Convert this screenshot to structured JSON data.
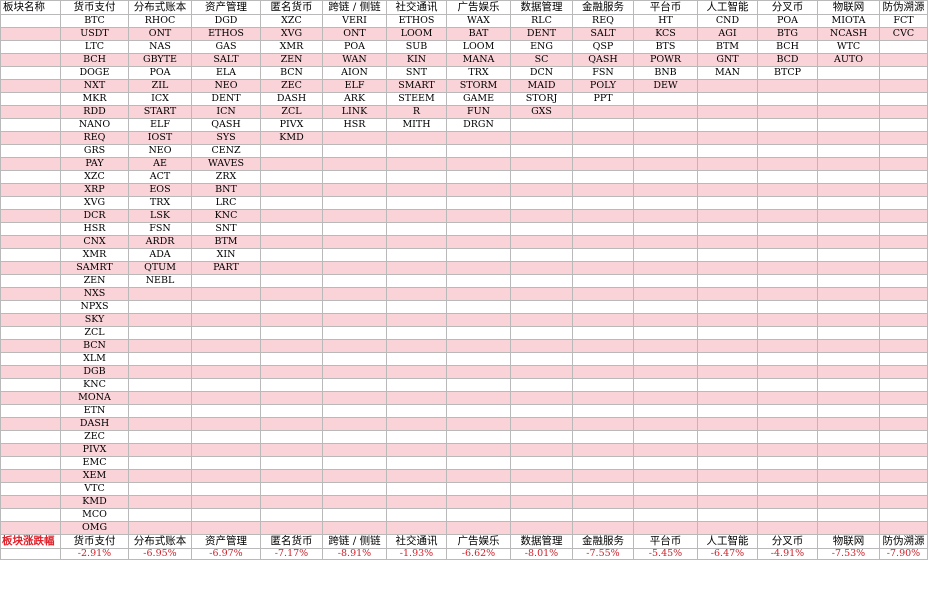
{
  "header": {
    "corner": "板块名称",
    "sectors": [
      "货币支付",
      "分布式账本",
      "资产管理",
      "匿名货币",
      "跨链 / 侧链",
      "社交通讯",
      "广告娱乐",
      "数据管理",
      "金融服务",
      "平台币",
      "人工智能",
      "分叉币",
      "物联网",
      "防伪溯源"
    ]
  },
  "columns": [
    [
      "BTC",
      "USDT",
      "LTC",
      "BCH",
      "DOGE",
      "NXT",
      "MKR",
      "RDD",
      "NANO",
      "REQ",
      "GRS",
      "PAY",
      "XZC",
      "XRP",
      "XVG",
      "DCR",
      "HSR",
      "CNX",
      "XMR",
      "SAMRT",
      "ZEN",
      "NXS",
      "NPXS",
      "SKY",
      "ZCL",
      "BCN",
      "XLM",
      "DGB",
      "KNC",
      "MONA",
      "ETN",
      "DASH",
      "ZEC",
      "PIVX",
      "EMC",
      "XEM",
      "VTC",
      "KMD",
      "MCO",
      "OMG"
    ],
    [
      "RHOC",
      "ONT",
      "NAS",
      "GBYTE",
      "POA",
      "ZIL",
      "ICX",
      "START",
      "ELF",
      "IOST",
      "NEO",
      "AE",
      "ACT",
      "EOS",
      "TRX",
      "LSK",
      "FSN",
      "ARDR",
      "ADA",
      "QTUM",
      "NEBL"
    ],
    [
      "DGD",
      "ETHOS",
      "GAS",
      "SALT",
      "ELA",
      "NEO",
      "DENT",
      "ICN",
      "QASH",
      "SYS",
      "CENZ",
      "WAVES",
      "ZRX",
      "BNT",
      "LRC",
      "KNC",
      "SNT",
      "BTM",
      "XIN",
      "PART"
    ],
    [
      "XZC",
      "XVG",
      "XMR",
      "ZEN",
      "BCN",
      "ZEC",
      "DASH",
      "ZCL",
      "PIVX",
      "KMD"
    ],
    [
      "VERI",
      "ONT",
      "POA",
      "WAN",
      "AION",
      "ELF",
      "ARK",
      "LINK",
      "HSR"
    ],
    [
      "ETHOS",
      "LOOM",
      "SUB",
      "KIN",
      "SNT",
      "SMART",
      "STEEM",
      "R",
      "MITH"
    ],
    [
      "WAX",
      "BAT",
      "LOOM",
      "MANA",
      "TRX",
      "STORM",
      "GAME",
      "FUN",
      "DRGN"
    ],
    [
      "RLC",
      "DENT",
      "ENG",
      "SC",
      "DCN",
      "MAID",
      "STORJ",
      "GXS"
    ],
    [
      "REQ",
      "SALT",
      "QSP",
      "QASH",
      "FSN",
      "POLY",
      "PPT"
    ],
    [
      "HT",
      "KCS",
      "BTS",
      "POWR",
      "BNB",
      "DEW"
    ],
    [
      "CND",
      "AGI",
      "BTM",
      "GNT",
      "MAN"
    ],
    [
      "POA",
      "BTG",
      "BCH",
      "BCD",
      "BTCP"
    ],
    [
      "MIOTA",
      "NCASH",
      "WTC",
      "AUTO"
    ],
    [
      "FCT",
      "CVC"
    ]
  ],
  "footer": {
    "label": "板块涨跌幅",
    "sectors": [
      "货币支付",
      "分布式账本",
      "资产管理",
      "匿名货币",
      "跨链 / 侧链",
      "社交通讯",
      "广告娱乐",
      "数据管理",
      "金融服务",
      "平台币",
      "人工智能",
      "分叉币",
      "物联网",
      "防伪溯源"
    ],
    "changes": [
      "-2.91%",
      "-6.95%",
      "-6.97%",
      "-7.17%",
      "-8.91%",
      "-1.93%",
      "-6.62%",
      "-8.01%",
      "-7.55%",
      "-5.45%",
      "-6.47%",
      "-4.91%",
      "-7.53%",
      "-7.90%"
    ]
  },
  "colors": {
    "band": "#f9d3d8",
    "grid": "#b9b9b9",
    "negative": "#d0202a",
    "footer_label": "#e0202a"
  }
}
